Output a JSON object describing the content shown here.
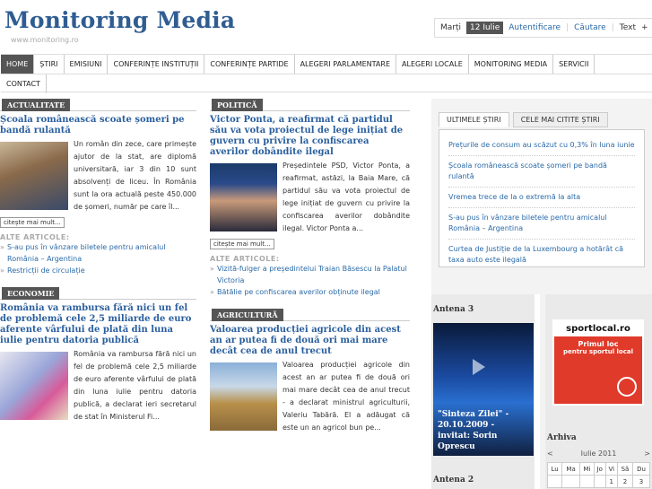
{
  "site": {
    "title": "Monitoring Media",
    "url": "www.monitoring.ro"
  },
  "topbar": {
    "day": "Marți",
    "date": "12 Iulie",
    "login": "Autentificare",
    "search": "Căutare",
    "text": "Text",
    "plus": "+",
    "times": "×",
    "minus": "–"
  },
  "nav": {
    "row1": [
      "HOME",
      "ȘTIRI",
      "EMISIUNI",
      "CONFERINȚE INSTITUȚII",
      "CONFERINȚE PARTIDE",
      "ALEGERI PARLAMENTARE",
      "ALEGERI LOCALE",
      "MONITORING MEDIA",
      "SERVICII"
    ],
    "row2": [
      "CONTACT"
    ]
  },
  "actualitate": {
    "tag": "ACTUALITATE",
    "title": "Școala românească scoate șomeri pe bandă rulantă",
    "text": "Un român din zece, care primește ajutor de la stat, are diplomă universitară, iar 3 din 10 sunt absolvenți de liceu. În România sunt la ora actuală peste 450.000 de șomeri, număr pe care îl...",
    "more": "citește mai mult...",
    "also": "ALTE ARTICOLE:",
    "links": [
      "S-au pus în vânzare biletele pentru amicalul România – Argentina",
      "Restricții de circulație"
    ]
  },
  "economie": {
    "tag": "ECONOMIE",
    "title": "România va rambursa fără nici un fel de problemă cele 2,5 miliarde de euro aferente vârfului de plată din luna iulie pentru datoria publică",
    "text": "România va rambursa fără nici un fel de problemă cele 2,5 miliarde de euro aferente vârfului de plată din luna iulie pentru datoria publică, a declarat ieri secretarul de stat în Ministerul Fi..."
  },
  "politica": {
    "tag": "POLITICĂ",
    "title": "Victor Ponta, a reafirmat că partidul său va vota proiectul de lege inițiat de guvern cu privire la confiscarea averilor dobândite ilegal",
    "text": "Președintele PSD, Victor Ponta, a reafirmat, astăzi, la Baia Mare, că partidul său va vota proiectul de lege inițiat de guvern cu privire la confiscarea averilor dobândite ilegal. Victor Ponta a...",
    "more": "citește mai mult...",
    "also": "ALTE ARTICOLE:",
    "links": [
      "Vizită-fulger a președintelui Traian Băsescu la Palatul Victoria",
      "Bătălie pe confiscarea averilor obținute ilegal"
    ]
  },
  "agricultura": {
    "tag": "AGRICULTURĂ",
    "title": "Valoarea producției agricole din acest an ar putea fi de două ori mai mare decât cea de anul trecut",
    "text": "Valoarea producției agricole din acest an ar putea fi de două ori mai mare decât cea de anul trecut - a declarat ministrul agriculturii, Valeriu Tabără. El a adăugat că este un an agricol bun pe..."
  },
  "tabs": {
    "latest": "ULTIMELE ȘTIRI",
    "most_read": "CELE MAI CITITE ȘTIRI",
    "items": [
      "Prețurile de consum au scăzut cu 0,3% în luna iunie",
      "Școala românească scoate șomeri pe bandă rulantă",
      "Vremea trece de la o extremă la alta",
      "S-au pus în vânzare biletele pentru amicalul România – Argentina",
      "Curtea de Justiție de la Luxembourg a hotărât că taxa auto este ilegală"
    ]
  },
  "antena3": {
    "head": "Antena 3",
    "caption": "\"Sinteza Zilei\" - 20.10.2009 - invitat: Sorin Oprescu"
  },
  "antena2": {
    "head": "Antena 2"
  },
  "sportlocal": {
    "brand": "sportlocal.ro",
    "line1": "Primul loc",
    "line2": "pentru sportul local"
  },
  "arhiva": {
    "head": "Arhiva",
    "month": "Iulie 2011",
    "prev": "<",
    "next": ">",
    "days": [
      "Lu",
      "Ma",
      "Mi",
      "Jo",
      "Vi",
      "Sâ",
      "Du"
    ],
    "first_row": [
      "",
      "",
      "",
      "",
      "1",
      "2",
      "3"
    ]
  },
  "colors": {
    "accent": "#2a5f9e",
    "logo": "#2f5d91",
    "tag_bg": "#555555"
  }
}
